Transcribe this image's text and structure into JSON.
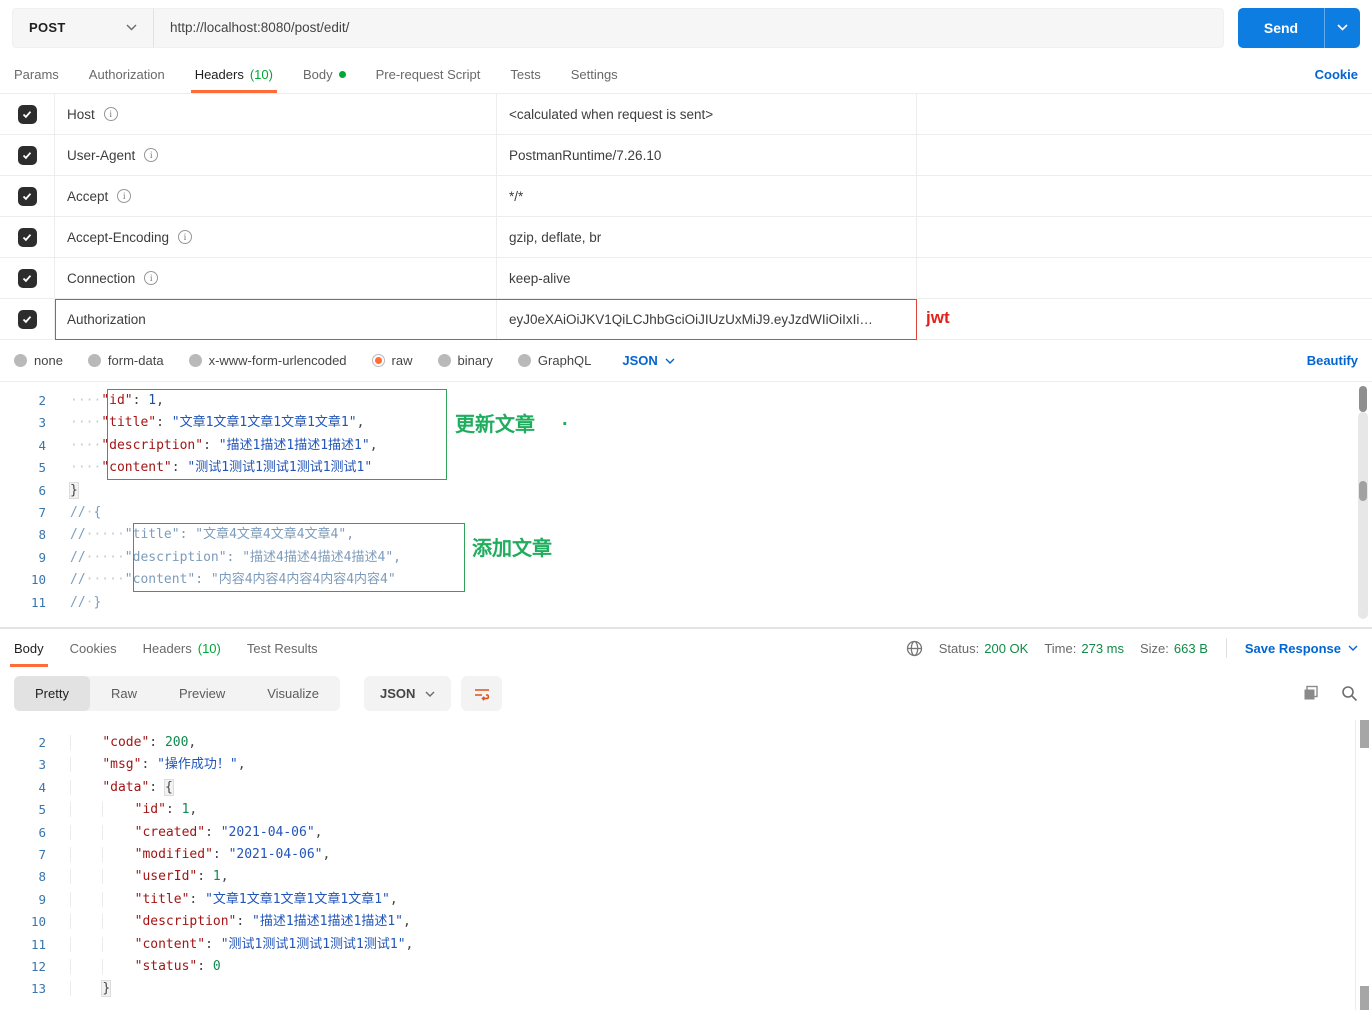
{
  "topbar": {
    "method": "POST",
    "url": "http://localhost:8080/post/edit/",
    "send": "Send"
  },
  "request_tabs": {
    "params": "Params",
    "authorization": "Authorization",
    "headers": "Headers",
    "headers_count": "(10)",
    "body": "Body",
    "prerequest": "Pre-request Script",
    "tests": "Tests",
    "settings": "Settings",
    "cookie_link": "Cookie"
  },
  "headers_table": {
    "rows": [
      {
        "key": "Host",
        "value": "<calculated when request is sent>"
      },
      {
        "key": "User-Agent",
        "value": "PostmanRuntime/7.26.10"
      },
      {
        "key": "Accept",
        "value": "*/*"
      },
      {
        "key": "Accept-Encoding",
        "value": "gzip, deflate, br"
      },
      {
        "key": "Connection",
        "value": "keep-alive"
      },
      {
        "key": "Authorization",
        "value": "eyJ0eXAiOiJKV1QiLCJhbGciOiJIUzUxMiJ9.eyJzdWIiOiIxIi…"
      }
    ],
    "jwt_label": "jwt"
  },
  "body_bar": {
    "modes": [
      "none",
      "form-data",
      "x-www-form-urlencoded",
      "raw",
      "binary",
      "GraphQL"
    ],
    "selected": "raw",
    "language": "JSON",
    "beautify": "Beautify"
  },
  "request_editor": {
    "annotation_update": "更新文章",
    "annotation_update_dot": ".",
    "annotation_add": "添加文章",
    "lines": [
      {
        "n": "2",
        "tokens": [
          [
            "ws",
            "····"
          ],
          [
            "key",
            "\"id\""
          ],
          [
            "p",
            ": "
          ],
          [
            "num",
            "1"
          ],
          [
            "p",
            ","
          ]
        ]
      },
      {
        "n": "3",
        "tokens": [
          [
            "ws",
            "····"
          ],
          [
            "key",
            "\"title\""
          ],
          [
            "p",
            ": "
          ],
          [
            "str",
            "\"文章1文章1文章1文章1文章1\""
          ],
          [
            "p",
            ","
          ]
        ]
      },
      {
        "n": "4",
        "tokens": [
          [
            "ws",
            "····"
          ],
          [
            "key",
            "\"description\""
          ],
          [
            "p",
            ": "
          ],
          [
            "str",
            "\"描述1描述1描述1描述1\""
          ],
          [
            "p",
            ","
          ]
        ]
      },
      {
        "n": "5",
        "tokens": [
          [
            "ws",
            "····"
          ],
          [
            "key",
            "\"content\""
          ],
          [
            "p",
            ": "
          ],
          [
            "str",
            "\"测试1测试1测试1测试1测试1\""
          ]
        ]
      },
      {
        "n": "6",
        "tokens": [
          [
            "brk",
            "}"
          ]
        ]
      },
      {
        "n": "7",
        "tokens": [
          [
            "cmt",
            "//"
          ],
          [
            "ws",
            "·"
          ],
          [
            "cmt",
            "{"
          ]
        ]
      },
      {
        "n": "8",
        "tokens": [
          [
            "cmt",
            "//"
          ],
          [
            "ws",
            "·····"
          ],
          [
            "cmt",
            "\"title\": \"文章4文章4文章4文章4\","
          ]
        ]
      },
      {
        "n": "9",
        "tokens": [
          [
            "cmt",
            "//"
          ],
          [
            "ws",
            "·····"
          ],
          [
            "cmt",
            "\"description\": \"描述4描述4描述4描述4\","
          ]
        ]
      },
      {
        "n": "10",
        "tokens": [
          [
            "cmt",
            "//"
          ],
          [
            "ws",
            "·····"
          ],
          [
            "cmt",
            "\"content\": \"内容4内容4内容4内容4内容4\""
          ]
        ]
      },
      {
        "n": "11",
        "tokens": [
          [
            "cmt",
            "//"
          ],
          [
            "ws",
            "·"
          ],
          [
            "cmt",
            "}"
          ]
        ]
      }
    ]
  },
  "response_bar": {
    "tab_body": "Body",
    "tab_cookies": "Cookies",
    "tab_headers": "Headers",
    "tab_headers_count": "(10)",
    "tab_test_results": "Test Results",
    "status_label": "Status:",
    "status_value": "200 OK",
    "time_label": "Time:",
    "time_value": "273 ms",
    "size_label": "Size:",
    "size_value": "663 B",
    "save_response": "Save Response"
  },
  "response_toolbar": {
    "views": [
      "Pretty",
      "Raw",
      "Preview",
      "Visualize"
    ],
    "active_view": "Pretty",
    "language": "JSON"
  },
  "response_editor": {
    "lines": [
      {
        "n": "2",
        "tokens": [
          [
            "ind",
            "    "
          ],
          [
            "key",
            "\"code\""
          ],
          [
            "p",
            ": "
          ],
          [
            "num",
            "200"
          ],
          [
            "p",
            ","
          ]
        ]
      },
      {
        "n": "3",
        "tokens": [
          [
            "ind",
            "    "
          ],
          [
            "key",
            "\"msg\""
          ],
          [
            "p",
            ": "
          ],
          [
            "str",
            "\"操作成功！\""
          ],
          [
            "p",
            ","
          ]
        ]
      },
      {
        "n": "4",
        "tokens": [
          [
            "ind",
            "    "
          ],
          [
            "key",
            "\"data\""
          ],
          [
            "p",
            ": "
          ],
          [
            "brk",
            "{"
          ]
        ]
      },
      {
        "n": "5",
        "tokens": [
          [
            "ind",
            "    "
          ],
          [
            "ind",
            "    "
          ],
          [
            "key",
            "\"id\""
          ],
          [
            "p",
            ": "
          ],
          [
            "num",
            "1"
          ],
          [
            "p",
            ","
          ]
        ]
      },
      {
        "n": "6",
        "tokens": [
          [
            "ind",
            "    "
          ],
          [
            "ind",
            "    "
          ],
          [
            "key",
            "\"created\""
          ],
          [
            "p",
            ": "
          ],
          [
            "str",
            "\"2021-04-06\""
          ],
          [
            "p",
            ","
          ]
        ]
      },
      {
        "n": "7",
        "tokens": [
          [
            "ind",
            "    "
          ],
          [
            "ind",
            "    "
          ],
          [
            "key",
            "\"modified\""
          ],
          [
            "p",
            ": "
          ],
          [
            "str",
            "\"2021-04-06\""
          ],
          [
            "p",
            ","
          ]
        ]
      },
      {
        "n": "8",
        "tokens": [
          [
            "ind",
            "    "
          ],
          [
            "ind",
            "    "
          ],
          [
            "key",
            "\"userId\""
          ],
          [
            "p",
            ": "
          ],
          [
            "num",
            "1"
          ],
          [
            "p",
            ","
          ]
        ]
      },
      {
        "n": "9",
        "tokens": [
          [
            "ind",
            "    "
          ],
          [
            "ind",
            "    "
          ],
          [
            "key",
            "\"title\""
          ],
          [
            "p",
            ": "
          ],
          [
            "str",
            "\"文章1文章1文章1文章1文章1\""
          ],
          [
            "p",
            ","
          ]
        ]
      },
      {
        "n": "10",
        "tokens": [
          [
            "ind",
            "    "
          ],
          [
            "ind",
            "    "
          ],
          [
            "key",
            "\"description\""
          ],
          [
            "p",
            ": "
          ],
          [
            "str",
            "\"描述1描述1描述1描述1\""
          ],
          [
            "p",
            ","
          ]
        ]
      },
      {
        "n": "11",
        "tokens": [
          [
            "ind",
            "    "
          ],
          [
            "ind",
            "    "
          ],
          [
            "key",
            "\"content\""
          ],
          [
            "p",
            ": "
          ],
          [
            "str",
            "\"测试1测试1测试1测试1测试1\""
          ],
          [
            "p",
            ","
          ]
        ]
      },
      {
        "n": "12",
        "tokens": [
          [
            "ind",
            "    "
          ],
          [
            "ind",
            "    "
          ],
          [
            "key",
            "\"status\""
          ],
          [
            "p",
            ": "
          ],
          [
            "num",
            "0"
          ]
        ]
      },
      {
        "n": "13",
        "tokens": [
          [
            "ind",
            "    "
          ],
          [
            "brk",
            "}"
          ]
        ]
      }
    ]
  },
  "icons": {
    "method_chevron": "chevron-down",
    "send_chevron": "chevron-down",
    "info": "info-circle",
    "globe": "globe",
    "copy": "copy",
    "search": "magnifier",
    "wrap": "text-wrap"
  },
  "colors": {
    "accent_orange": "#ff6c37",
    "link_blue": "#0265d2",
    "count_green": "#00a737",
    "status_green": "#118a46",
    "annotation_green": "#1fad5e",
    "jwt_red": "#e0241b",
    "send_blue": "#0d7de2"
  }
}
